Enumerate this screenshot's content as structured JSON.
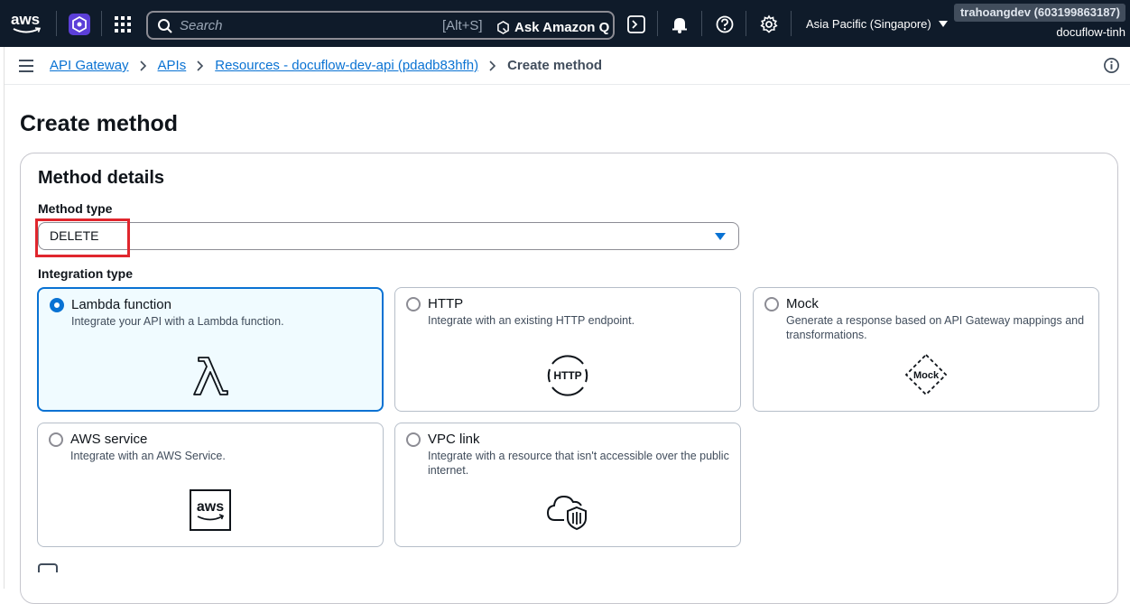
{
  "topnav": {
    "logo_text": "aws",
    "search": {
      "placeholder": "Search",
      "shortcut": "[Alt+S]",
      "ask_label": "Ask Amazon Q"
    },
    "region": "Asia Pacific (Singapore)",
    "account": "trahoangdev (603199863187)",
    "user": "docuflow-tinh"
  },
  "breadcrumb": {
    "items": [
      "API Gateway",
      "APIs",
      "Resources - docuflow-dev-api (pdadb83hfh)"
    ],
    "current": "Create method"
  },
  "page": {
    "title": "Create method",
    "section_title": "Method details",
    "method_type_label": "Method type",
    "method_type_value": "DELETE",
    "integration_type_label": "Integration type"
  },
  "integration_options": [
    {
      "title": "Lambda function",
      "desc": "Integrate your API with a Lambda function.",
      "icon": "lambda-icon",
      "selected": true
    },
    {
      "title": "HTTP",
      "desc": "Integrate with an existing HTTP endpoint.",
      "icon": "http-icon",
      "icon_text": "HTTP",
      "selected": false
    },
    {
      "title": "Mock",
      "desc": "Generate a response based on API Gateway mappings and transformations.",
      "icon": "mock-icon",
      "icon_text": "Mock",
      "selected": false
    },
    {
      "title": "AWS service",
      "desc": "Integrate with an AWS Service.",
      "icon": "aws-icon",
      "icon_text": "aws",
      "selected": false
    },
    {
      "title": "VPC link",
      "desc": "Integrate with a resource that isn't accessible over the public internet.",
      "icon": "vpc-link-icon",
      "selected": false
    }
  ],
  "colors": {
    "accent": "#0972d3",
    "nav_bg": "#0f1b2a",
    "highlight": "#e0262d",
    "selected_bg": "#f0fbff"
  }
}
